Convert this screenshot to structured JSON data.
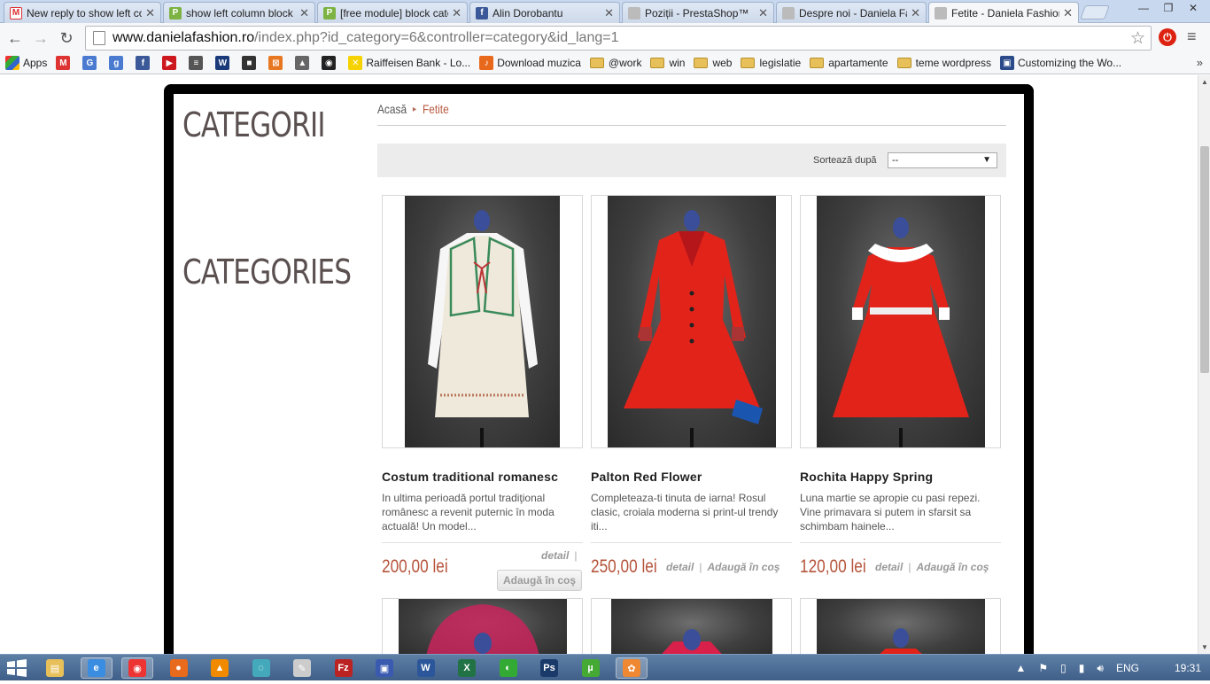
{
  "browser": {
    "tabs": [
      {
        "title": "New reply to show left column",
        "icon": "gmail-icon",
        "color": "#d33",
        "active": false
      },
      {
        "title": "show left column block categories",
        "icon": "prestashop-icon",
        "color": "#7cb342",
        "active": false
      },
      {
        "title": "[free module] block categories",
        "icon": "prestashop-icon",
        "color": "#7cb342",
        "active": false
      },
      {
        "title": "Alin Dorobantu",
        "icon": "facebook-icon",
        "color": "#3b5998",
        "active": false
      },
      {
        "title": "Poziții - PrestaShop™",
        "icon": "page-icon",
        "color": "#aaa",
        "active": false
      },
      {
        "title": "Despre noi - Daniela Fashion",
        "icon": "page-icon",
        "color": "#aaa",
        "active": false
      },
      {
        "title": "Fetite - Daniela Fashion",
        "icon": "page-icon",
        "color": "#aaa",
        "active": true
      }
    ],
    "url_host": "www.danielafashion.ro",
    "url_path": "/index.php?id_category=6&controller=category&id_lang=1",
    "bookmarks": [
      {
        "label": "Apps",
        "type": "apps"
      },
      {
        "label": "",
        "type": "icon",
        "color": "#d33",
        "glyph": "M"
      },
      {
        "label": "",
        "type": "icon",
        "color": "#4a7bd0",
        "glyph": "G"
      },
      {
        "label": "",
        "type": "icon",
        "color": "#4a7bd0",
        "glyph": "g"
      },
      {
        "label": "",
        "type": "icon",
        "color": "#3b5998",
        "glyph": "f"
      },
      {
        "label": "",
        "type": "icon",
        "color": "#cc181e",
        "glyph": "▶"
      },
      {
        "label": "",
        "type": "icon",
        "color": "#555",
        "glyph": "≡"
      },
      {
        "label": "",
        "type": "icon",
        "color": "#1a3a7a",
        "glyph": "W"
      },
      {
        "label": "",
        "type": "icon",
        "color": "#333",
        "glyph": "■"
      },
      {
        "label": "",
        "type": "icon",
        "color": "#e87722",
        "glyph": "⊠"
      },
      {
        "label": "",
        "type": "icon",
        "color": "#666",
        "glyph": "▲"
      },
      {
        "label": "",
        "type": "icon",
        "color": "#222",
        "glyph": "◉"
      },
      {
        "label": "Raiffeisen Bank - Lo...",
        "type": "icon",
        "color": "#f5d200",
        "glyph": "✕"
      },
      {
        "label": "Download muzica",
        "type": "icon",
        "color": "#e8691c",
        "glyph": "♪"
      },
      {
        "label": "@work",
        "type": "folder"
      },
      {
        "label": "win",
        "type": "folder"
      },
      {
        "label": "web",
        "type": "folder"
      },
      {
        "label": "legislatie",
        "type": "folder"
      },
      {
        "label": "apartamente",
        "type": "folder"
      },
      {
        "label": "teme wordpress",
        "type": "folder"
      },
      {
        "label": "Customizing the Wo...",
        "type": "icon",
        "color": "#2a4a8a",
        "glyph": "▣"
      }
    ],
    "bookmarks_more": "»"
  },
  "page": {
    "left_titles": [
      "CATEGORII",
      "CATEGORIES"
    ],
    "breadcrumb": {
      "home": "Acasă",
      "separator": "▸",
      "current": "Fetite"
    },
    "sort": {
      "label": "Sortează după",
      "value": "--"
    },
    "products": [
      {
        "name": "Costum traditional romanesc",
        "desc": "  In ultima perioadă portul tradiţional românesc a revenit puternic în moda actuală! Un model...",
        "price": "200,00 lei",
        "detail": "detail",
        "cart": "Adaugă în coş",
        "cart_style": "button"
      },
      {
        "name": "Palton Red Flower",
        "desc": "      Completeaza-ti tinuta de iarna! Rosul clasic, croiala moderna si print-ul trendy iti...",
        "price": "250,00 lei",
        "detail": "detail",
        "cart": "Adaugă în coş",
        "cart_style": "link"
      },
      {
        "name": "Rochita Happy Spring",
        "desc": "  Luna martie se apropie cu pasi repezi. Vine primavara si putem in sfarsit sa schimbam hainele...",
        "price": "120,00 lei",
        "detail": "detail",
        "cart": "Adaugă în coş",
        "cart_style": "link"
      }
    ]
  },
  "taskbar": {
    "apps": [
      {
        "name": "explorer",
        "glyph": "▤",
        "color": "#e8c05a",
        "active": false
      },
      {
        "name": "ie",
        "glyph": "e",
        "color": "#3a8de0",
        "active": true
      },
      {
        "name": "chrome",
        "glyph": "◉",
        "color": "#e33",
        "active": true
      },
      {
        "name": "firefox",
        "glyph": "●",
        "color": "#e86a1c",
        "active": false
      },
      {
        "name": "vlc",
        "glyph": "▲",
        "color": "#f28a00",
        "active": false
      },
      {
        "name": "app",
        "glyph": "◌",
        "color": "#4ab",
        "active": false
      },
      {
        "name": "tool",
        "glyph": "✎",
        "color": "#ccc",
        "active": false
      },
      {
        "name": "filezilla",
        "glyph": "Fz",
        "color": "#b22",
        "active": false
      },
      {
        "name": "save",
        "glyph": "▣",
        "color": "#3a5ab0",
        "active": false
      },
      {
        "name": "word",
        "glyph": "W",
        "color": "#2b579a",
        "active": false
      },
      {
        "name": "excel",
        "glyph": "X",
        "color": "#217346",
        "active": false
      },
      {
        "name": "app2",
        "glyph": "◐",
        "color": "#3a3",
        "active": false
      },
      {
        "name": "photoshop",
        "glyph": "Ps",
        "color": "#1a3a6a",
        "active": false
      },
      {
        "name": "utorrent",
        "glyph": "µ",
        "color": "#4a3",
        "active": false
      },
      {
        "name": "paint",
        "glyph": "✿",
        "color": "#e83",
        "active": true
      }
    ],
    "lang": "ENG",
    "time": "19:31"
  }
}
